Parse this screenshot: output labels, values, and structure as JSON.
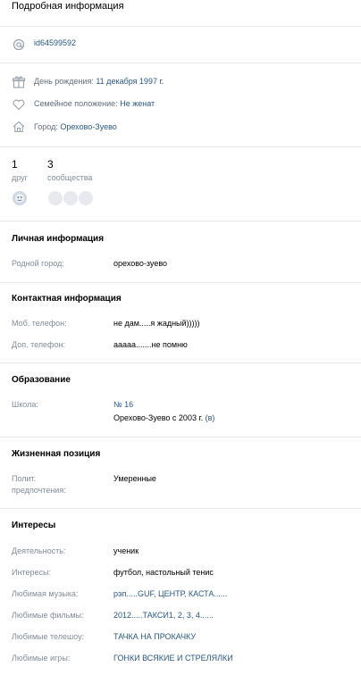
{
  "header": {
    "title": "Подробная информация"
  },
  "profile": {
    "id_link": "id64599592",
    "birthday_label": "День рождения:",
    "birthday_value": "11 декабря 1997 г.",
    "family_label": "Семейное положение:",
    "family_value": "Не женат",
    "city_label": "Город:",
    "city_value": "Орехово-Зуево"
  },
  "counters": {
    "friends_count": "1",
    "friends_label": "друг",
    "communities_count": "3",
    "communities_label": "сообщества"
  },
  "personal": {
    "heading": "Личная информация",
    "hometown_label": "Родной город:",
    "hometown_value": "орехово-зуево"
  },
  "contacts": {
    "heading": "Контактная информация",
    "mobile_label": "Моб. телефон:",
    "mobile_value": "не дам.....я жадный)))))",
    "extra_label": "Доп. телефон:",
    "extra_value": "ааааа.......не помню"
  },
  "education": {
    "heading": "Образование",
    "school_label": "Школа:",
    "school_value": "№ 16",
    "school_detail": "Орехово-Зуево с 2003 г.",
    "school_detail_link": "(в)"
  },
  "life_position": {
    "heading": "Жизненная позиция",
    "politics_label_1": "Полит.",
    "politics_label_2": "предпочтения:",
    "politics_value": "Умеренные"
  },
  "interests": {
    "heading": "Интересы",
    "rows": [
      {
        "label": "Деятельность:",
        "value": "ученик"
      },
      {
        "label": "Интересы:",
        "value": "футбол, настольный тенис"
      },
      {
        "label": "Любимая музыка:",
        "value": "рэп.....GUF, ЦЕНТР, КАСТА......"
      },
      {
        "label": "Любимые фильмы:",
        "value": "2012.....ТАКСИ1, 2, 3, 4......"
      },
      {
        "label": "Любимые телешоу:",
        "value": "ТАЧКА НА ПРОКАЧКУ"
      },
      {
        "label": "Любимые игры:",
        "value": "ГОНКИ ВСЯКИЕ И СТРЕЛЯЛКИ"
      }
    ]
  },
  "colors": {
    "link": "#2a5885",
    "label": "#818c99",
    "divider": "#e7e8ec"
  }
}
